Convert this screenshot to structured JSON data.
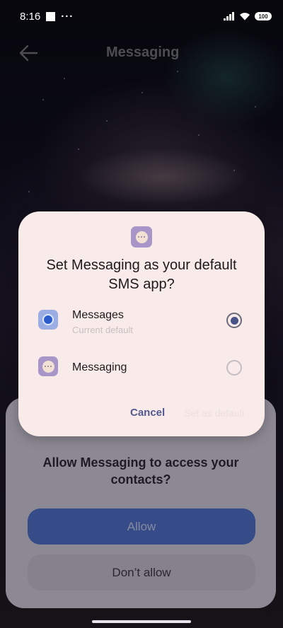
{
  "status_bar": {
    "time": "8:16",
    "dots": "···",
    "battery": "100"
  },
  "app_bar": {
    "title": "Messaging"
  },
  "permission_sheet": {
    "question": "Allow Messaging to access your contacts?",
    "allow_label": "Allow",
    "deny_label": "Don’t allow"
  },
  "dialog": {
    "title": "Set Messaging as your default SMS app?",
    "options": [
      {
        "name": "Messages",
        "subtitle": "Current default",
        "icon": "messages-app-icon",
        "selected": true
      },
      {
        "name": "Messaging",
        "subtitle": "",
        "icon": "messaging-app-icon",
        "selected": false
      }
    ],
    "cancel_label": "Cancel",
    "set_default_label": "Set as default"
  },
  "colors": {
    "dialog_bg": "#f8ebe9",
    "accent": "#53598f",
    "allow_button": "#3f69c9"
  }
}
